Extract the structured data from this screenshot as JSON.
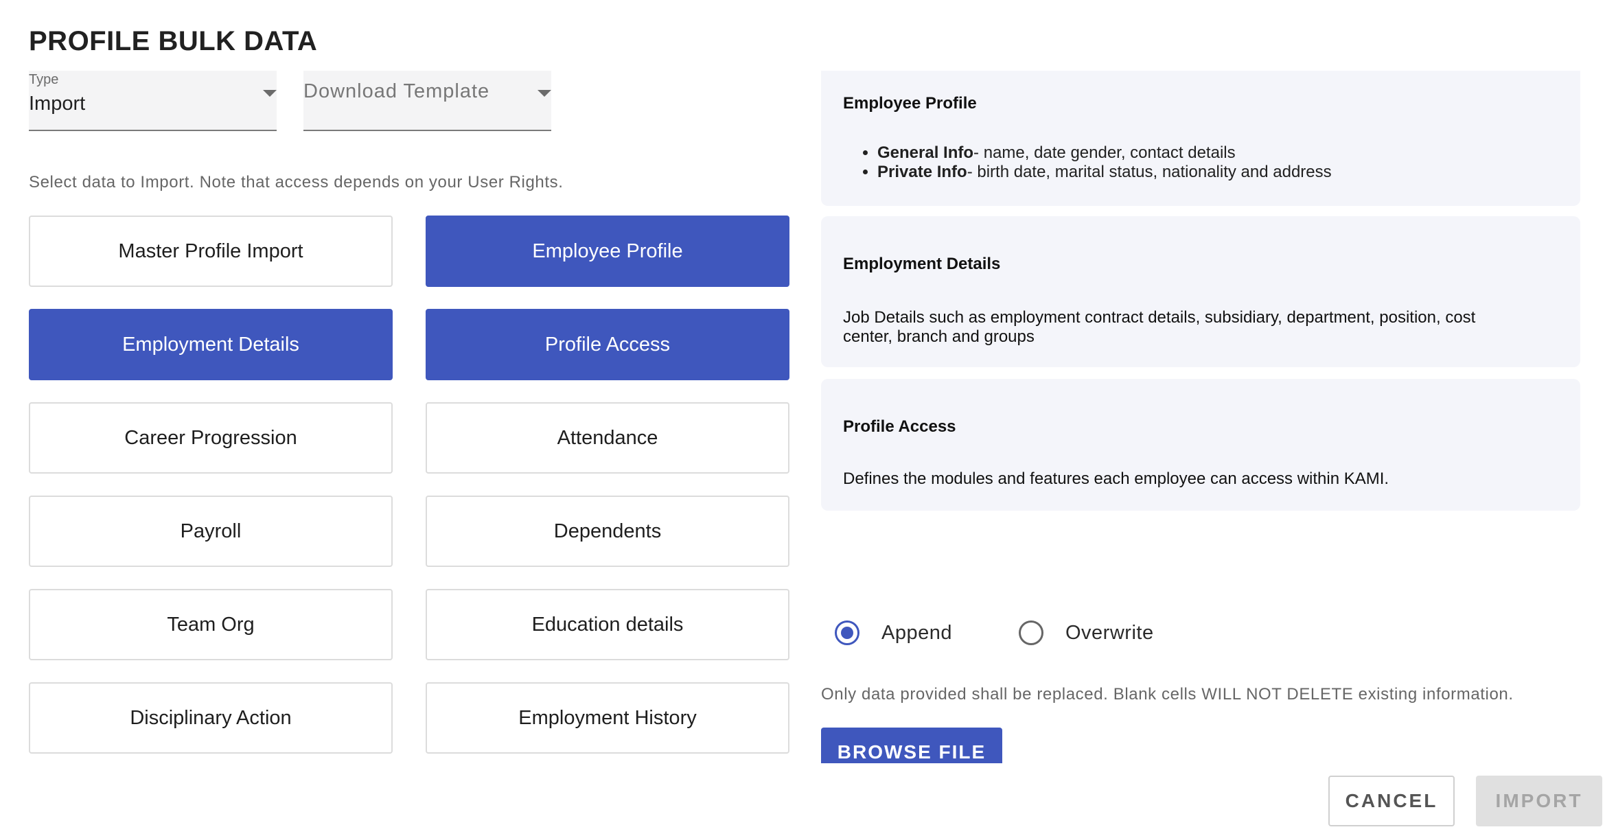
{
  "title": "PROFILE BULK DATA",
  "type_select": {
    "label": "Type",
    "value": "Import"
  },
  "template_select": {
    "placeholder": "Download Template"
  },
  "hint": "Select data to Import. Note that access depends on your User Rights.",
  "options": [
    {
      "label": "Master Profile Import",
      "selected": false
    },
    {
      "label": "Employee Profile",
      "selected": true
    },
    {
      "label": "Employment Details",
      "selected": true
    },
    {
      "label": "Profile Access",
      "selected": true
    },
    {
      "label": "Career Progression",
      "selected": false
    },
    {
      "label": "Attendance",
      "selected": false
    },
    {
      "label": "Payroll",
      "selected": false
    },
    {
      "label": "Dependents",
      "selected": false
    },
    {
      "label": "Team Org",
      "selected": false
    },
    {
      "label": "Education details",
      "selected": false
    },
    {
      "label": "Disciplinary Action",
      "selected": false
    },
    {
      "label": "Employment History",
      "selected": false
    }
  ],
  "cards": {
    "employee_profile": {
      "title": "Employee Profile",
      "items": [
        {
          "bold": "General Info",
          "text": "- name, date gender, contact details"
        },
        {
          "bold": "Private Info",
          "text": "- birth date, marital status, nationality and address"
        }
      ]
    },
    "employment_details": {
      "title": "Employment Details",
      "body": "Job Details such as employment contract details, subsidiary, department, position, cost center, branch and groups"
    },
    "profile_access": {
      "title": "Profile Access",
      "body": "Defines the modules and features each employee can access within KAMI."
    }
  },
  "mode": {
    "append": "Append",
    "overwrite": "Overwrite",
    "selected": "append"
  },
  "note": "Only data provided shall be replaced. Blank cells WILL NOT DELETE existing information.",
  "buttons": {
    "browse": "BROWSE FILE",
    "cancel": "CANCEL",
    "import": "IMPORT"
  },
  "colors": {
    "accent": "#3f57bd",
    "card_bg": "#f4f5fa",
    "disabled_bg": "#e0e0e0"
  }
}
